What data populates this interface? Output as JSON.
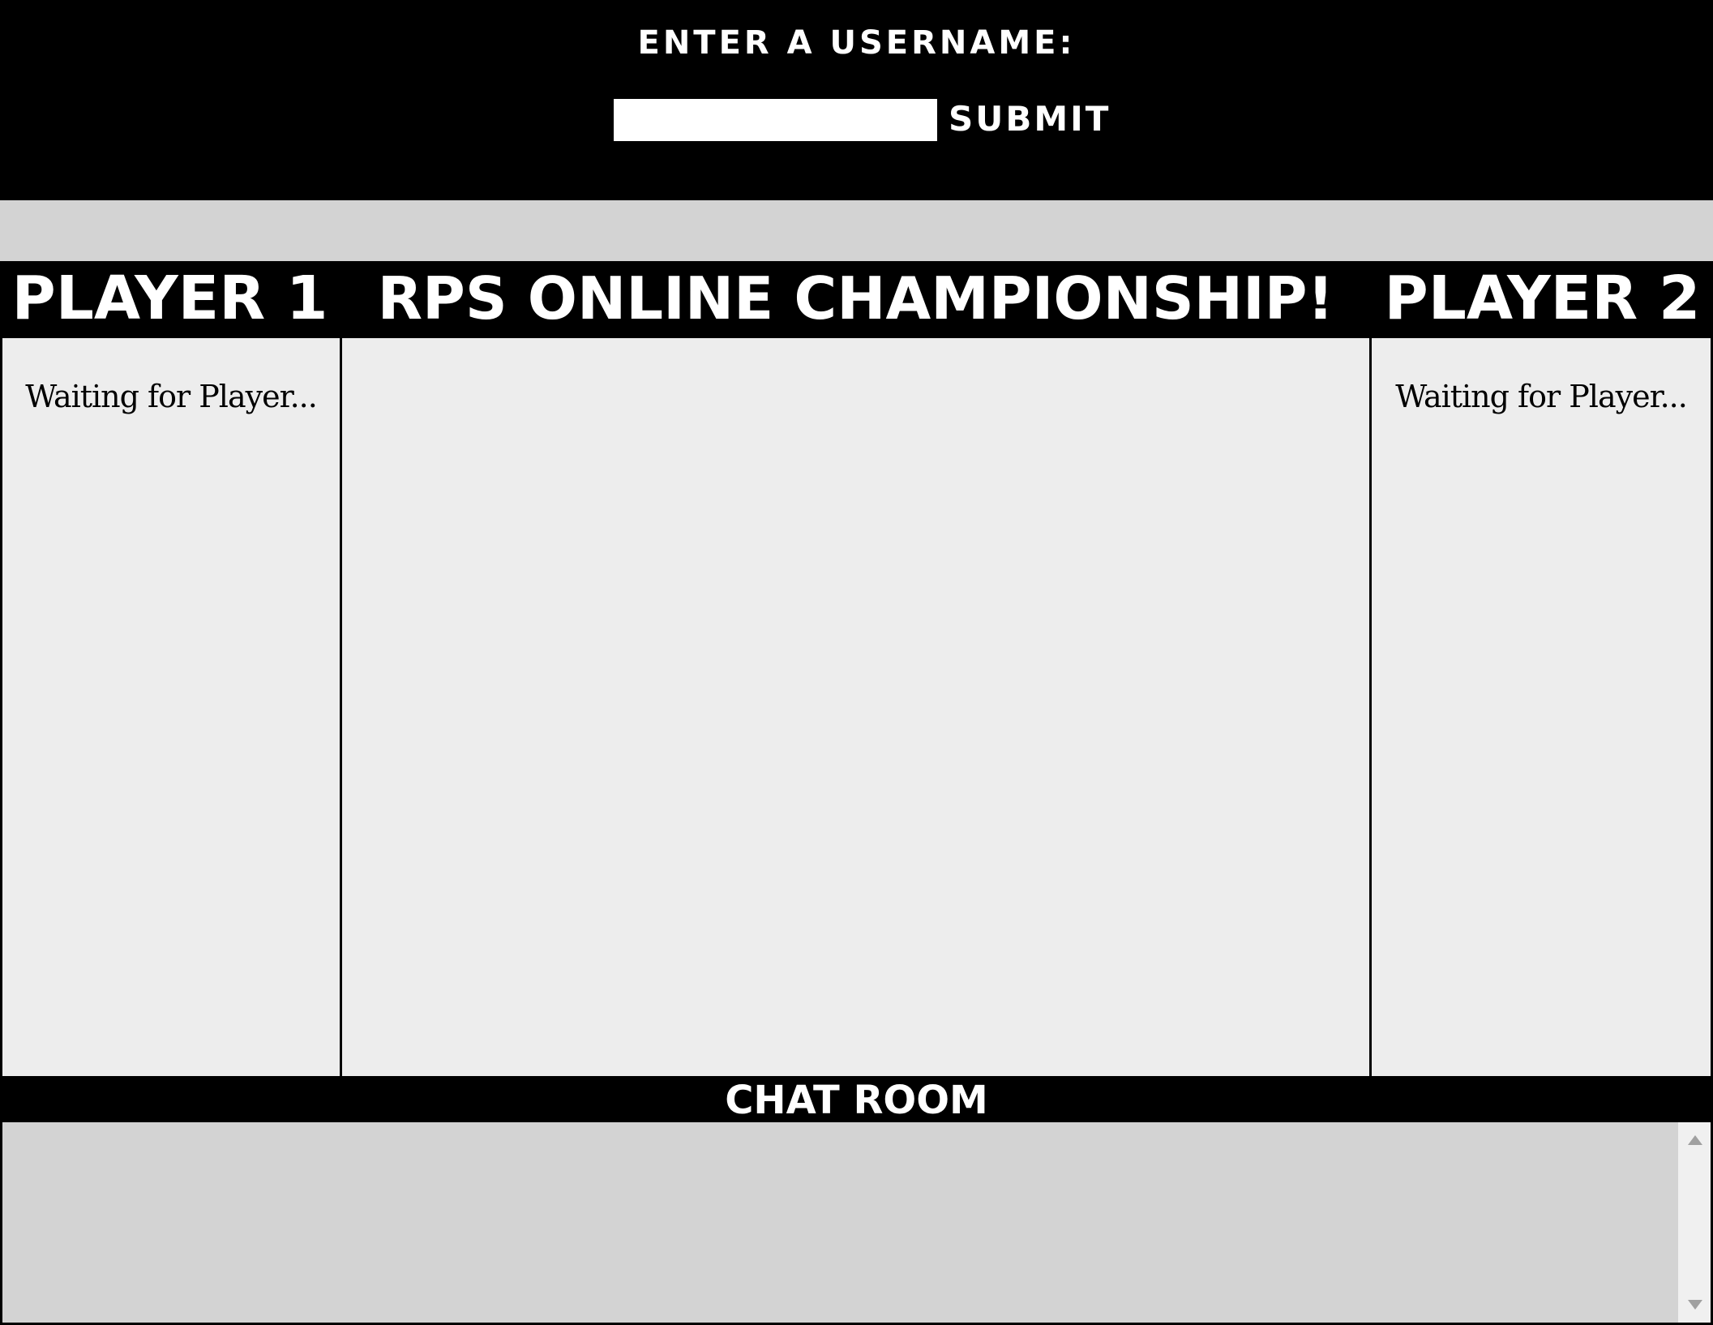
{
  "username_bar": {
    "prompt": "Enter a username:",
    "input_value": "",
    "input_placeholder": "",
    "submit_label": "Submit"
  },
  "header": {
    "player1": "Player 1",
    "title": "RPS Online Championship!",
    "player2": "Player 2"
  },
  "panels": {
    "player1_status": "Waiting for Player...",
    "player2_status": "Waiting for Player..."
  },
  "chat": {
    "title": "Chat Room"
  },
  "colors": {
    "bar": "#000000",
    "panel": "#ededed",
    "page": "#d3d3d3"
  }
}
